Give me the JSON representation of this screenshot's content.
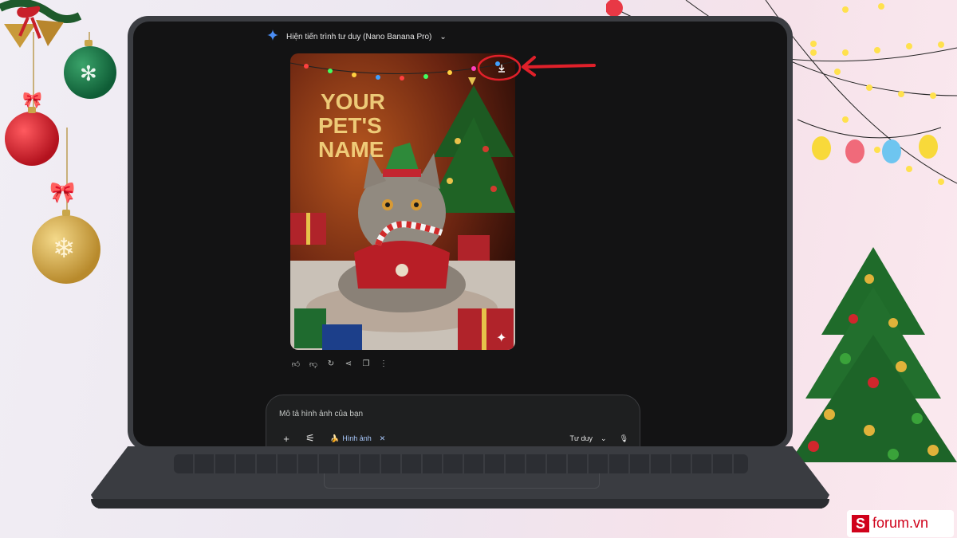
{
  "header": {
    "title": "Hiện tiến trình tư duy (Nano Banana Pro)"
  },
  "image_text": "YOUR PET'S NAME",
  "composer": {
    "placeholder": "Mô tả hình ảnh của bạn",
    "chip_label": "Hình ảnh",
    "chip_emoji": "🍌",
    "mode_label": "Tư duy"
  },
  "icons": {
    "spark": "gemini-spark-icon",
    "download": "download-icon",
    "like": "thumbs-up-icon",
    "dislike": "thumbs-down-icon",
    "regenerate": "refresh-icon",
    "share": "share-icon",
    "copy": "copy-icon",
    "more": "more-vert-icon",
    "add": "plus-icon",
    "tools": "tune-icon",
    "mic": "mic-icon"
  },
  "watermark": {
    "logo_letter": "S",
    "text": "forum.vn"
  },
  "colors": {
    "accent_blue": "#a8c7fa",
    "annotation_red": "#e0202a",
    "brand_red": "#d0021b"
  }
}
